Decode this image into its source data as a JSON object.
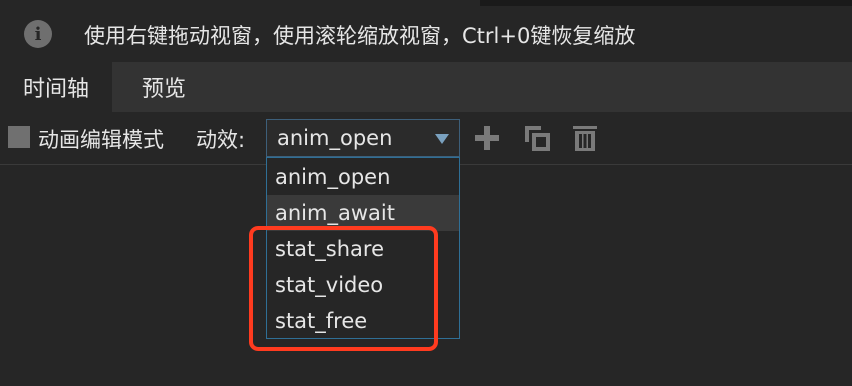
{
  "hint": {
    "icon": "info-icon",
    "text": "使用右键拖动视窗，使用滚轮缩放视窗，Ctrl+0键恢复缩放"
  },
  "tabs": [
    {
      "label": "时间轴",
      "active": true
    },
    {
      "label": "预览",
      "active": false
    }
  ],
  "toolbar": {
    "checkbox_label": "动画编辑模式",
    "checkbox_checked": false,
    "effect_label": "动效:",
    "selected_effect": "anim_open",
    "icons": [
      "add-icon",
      "duplicate-icon",
      "delete-icon"
    ]
  },
  "dropdown": {
    "options": [
      "anim_open",
      "anim_await",
      "stat_share",
      "stat_video",
      "stat_free"
    ],
    "hovered_index": 1
  },
  "colors": {
    "background": "#262626",
    "tab_bar": "#333333",
    "select_border": "#2f6f96",
    "highlight": "#ff3b1f"
  }
}
